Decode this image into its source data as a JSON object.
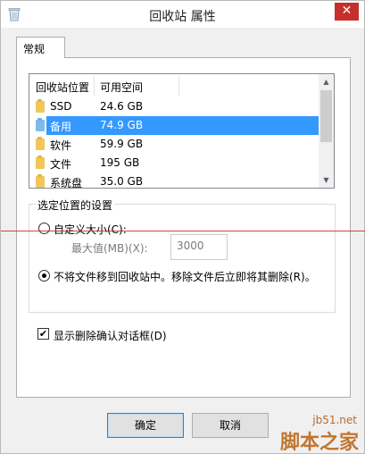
{
  "window": {
    "title": "回收站 属性",
    "close_label": "✕"
  },
  "tabs": [
    {
      "label": "常规"
    }
  ],
  "list": {
    "columns": [
      "回收站位置",
      "可用空间"
    ],
    "rows": [
      {
        "name": "SSD",
        "space": "24.6 GB",
        "selected": false
      },
      {
        "name": "备用",
        "space": "74.9 GB",
        "selected": true
      },
      {
        "name": "软件",
        "space": "59.9 GB",
        "selected": false
      },
      {
        "name": "文件",
        "space": "195 GB",
        "selected": false
      },
      {
        "name": "系统盘",
        "space": "35.0 GB",
        "selected": false
      }
    ],
    "scroll_up": "▲",
    "scroll_down": "▼"
  },
  "settings": {
    "group_title": "选定位置的设置",
    "custom_size_label": "自定义大小(C):",
    "max_label": "最大值(MB)(X):",
    "max_value": "3000",
    "no_move_label": "不将文件移到回收站中。移除文件后立即将其删除(R)。"
  },
  "confirm": {
    "label": "显示删除确认对话框(D)",
    "checked": true,
    "mark": "✔"
  },
  "buttons": {
    "ok": "确定",
    "cancel": "取消"
  },
  "watermark": {
    "line1": "jb51.net",
    "line2": "脚本之家"
  }
}
